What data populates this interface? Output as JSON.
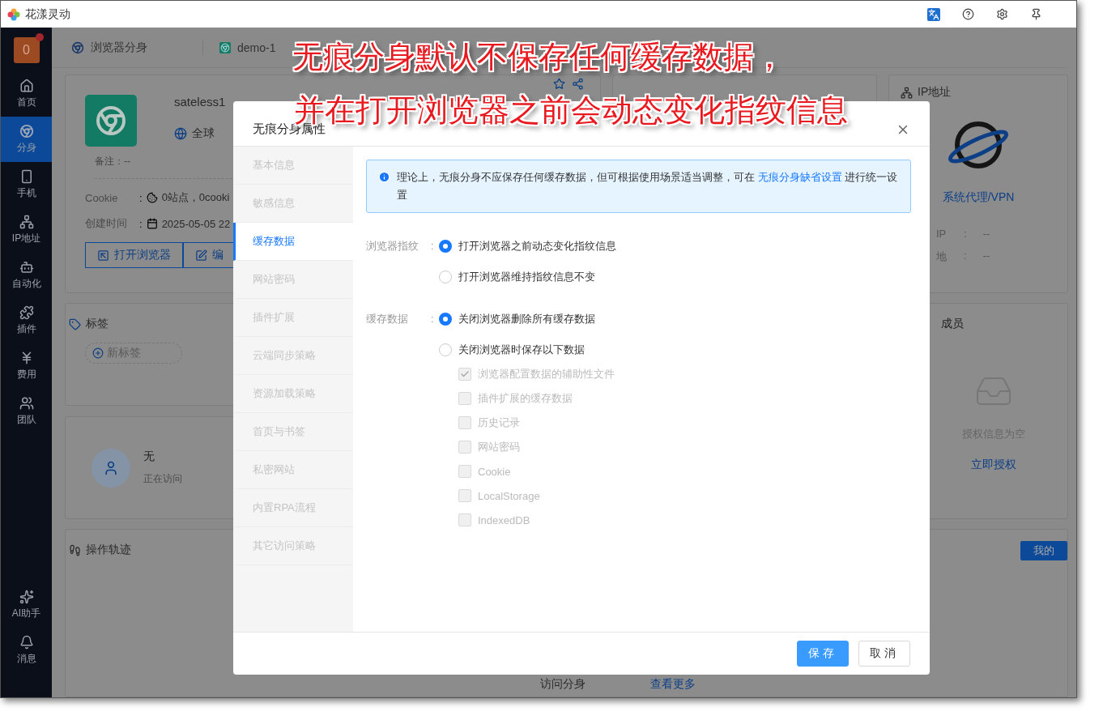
{
  "app": {
    "title": "花漾灵动"
  },
  "sidebar": {
    "badge": "0",
    "items": [
      {
        "label": "首页",
        "selected": false
      },
      {
        "label": "分身",
        "selected": true
      },
      {
        "label": "手机",
        "selected": false
      },
      {
        "label": "IP地址",
        "selected": false
      },
      {
        "label": "自动化",
        "selected": false
      },
      {
        "label": "插件",
        "selected": false
      },
      {
        "label": "费用",
        "selected": false
      },
      {
        "label": "团队",
        "selected": false
      }
    ],
    "bottom_items": [
      {
        "label": "AI助手"
      },
      {
        "label": "消息"
      }
    ]
  },
  "header": {
    "breadcrumb": "浏览器分身",
    "tab": "demo-1"
  },
  "profile": {
    "name": "sateless1",
    "region": "全球",
    "note": "备注：--",
    "fields": [
      {
        "label": "Cookie",
        "sep": ":",
        "value": "0站点，0cooki"
      },
      {
        "label": "创建时间",
        "sep": ":",
        "value": "2025-05-05 22"
      }
    ],
    "buttons": [
      "打开浏览器",
      "编"
    ]
  },
  "ip_card": {
    "title": "IP地址",
    "proxy": "系统代理/VPN",
    "rows": [
      {
        "label": "IP",
        "sep": ":",
        "value": "--"
      },
      {
        "label": "地",
        "sep": ":",
        "value": "--"
      }
    ]
  },
  "tags_card": {
    "title": "标签",
    "add": "新标签"
  },
  "visitor": {
    "name": "无",
    "status": "正在访问"
  },
  "members_card": {
    "title": "成员",
    "empty": "授权信息为空",
    "action": "立即授权"
  },
  "track_card": {
    "title": "操作轨迹",
    "filter": "我的",
    "footer": [
      {
        "text": "访问分身",
        "kind": "text"
      },
      {
        "text": "查看更多",
        "kind": "link"
      }
    ]
  },
  "dialog": {
    "title": "无痕分身属性",
    "nav": [
      {
        "label": "基本信息",
        "selected": false
      },
      {
        "label": "敏感信息",
        "selected": false
      },
      {
        "label": "缓存数据",
        "selected": true
      },
      {
        "label": "网站密码",
        "selected": false
      },
      {
        "label": "插件扩展",
        "selected": false
      },
      {
        "label": "云端同步策略",
        "selected": false
      },
      {
        "label": "资源加载策略",
        "selected": false
      },
      {
        "label": "首页与书签",
        "selected": false
      },
      {
        "label": "私密网站",
        "selected": false
      },
      {
        "label": "内置RPA流程",
        "selected": false
      },
      {
        "label": "其它访问策略",
        "selected": false
      }
    ],
    "alert": {
      "text": "理论上，无痕分身不应保存任何缓存数据，但可根据使用场景适当调整，可在",
      "link": "无痕分身缺省设置",
      "tail": "进行统一设置"
    },
    "groups": [
      {
        "label": "浏览器指纹",
        "sep": ":",
        "options": [
          {
            "label": "打开浏览器之前动态变化指纹信息",
            "selected": true
          },
          {
            "label": "打开浏览器维持指纹信息不变",
            "selected": false
          }
        ]
      },
      {
        "label": "缓存数据",
        "sep": ":",
        "options": [
          {
            "label": "关闭浏览器删除所有缓存数据",
            "selected": true
          },
          {
            "label": "关闭浏览器时保存以下数据",
            "selected": false
          }
        ],
        "items": [
          {
            "label": "浏览器配置数据的辅助性文件",
            "checked": true,
            "disabled": true
          },
          {
            "label": "插件扩展的缓存数据",
            "checked": false,
            "disabled": true
          },
          {
            "label": "历史记录",
            "checked": false,
            "disabled": true
          },
          {
            "label": "网站密码",
            "checked": false,
            "disabled": true
          },
          {
            "label": "Cookie",
            "checked": false,
            "disabled": true
          },
          {
            "label": "LocalStorage",
            "checked": false,
            "disabled": true
          },
          {
            "label": "IndexedDB",
            "checked": false,
            "disabled": true
          }
        ]
      }
    ],
    "buttons": [
      {
        "label": "保存",
        "kind": "primary"
      },
      {
        "label": "取消",
        "kind": "default"
      }
    ]
  },
  "annotation": [
    "无痕分身默认不保存任何缓存数据，",
    "并在打开浏览器之前会动态变化指纹信息"
  ]
}
